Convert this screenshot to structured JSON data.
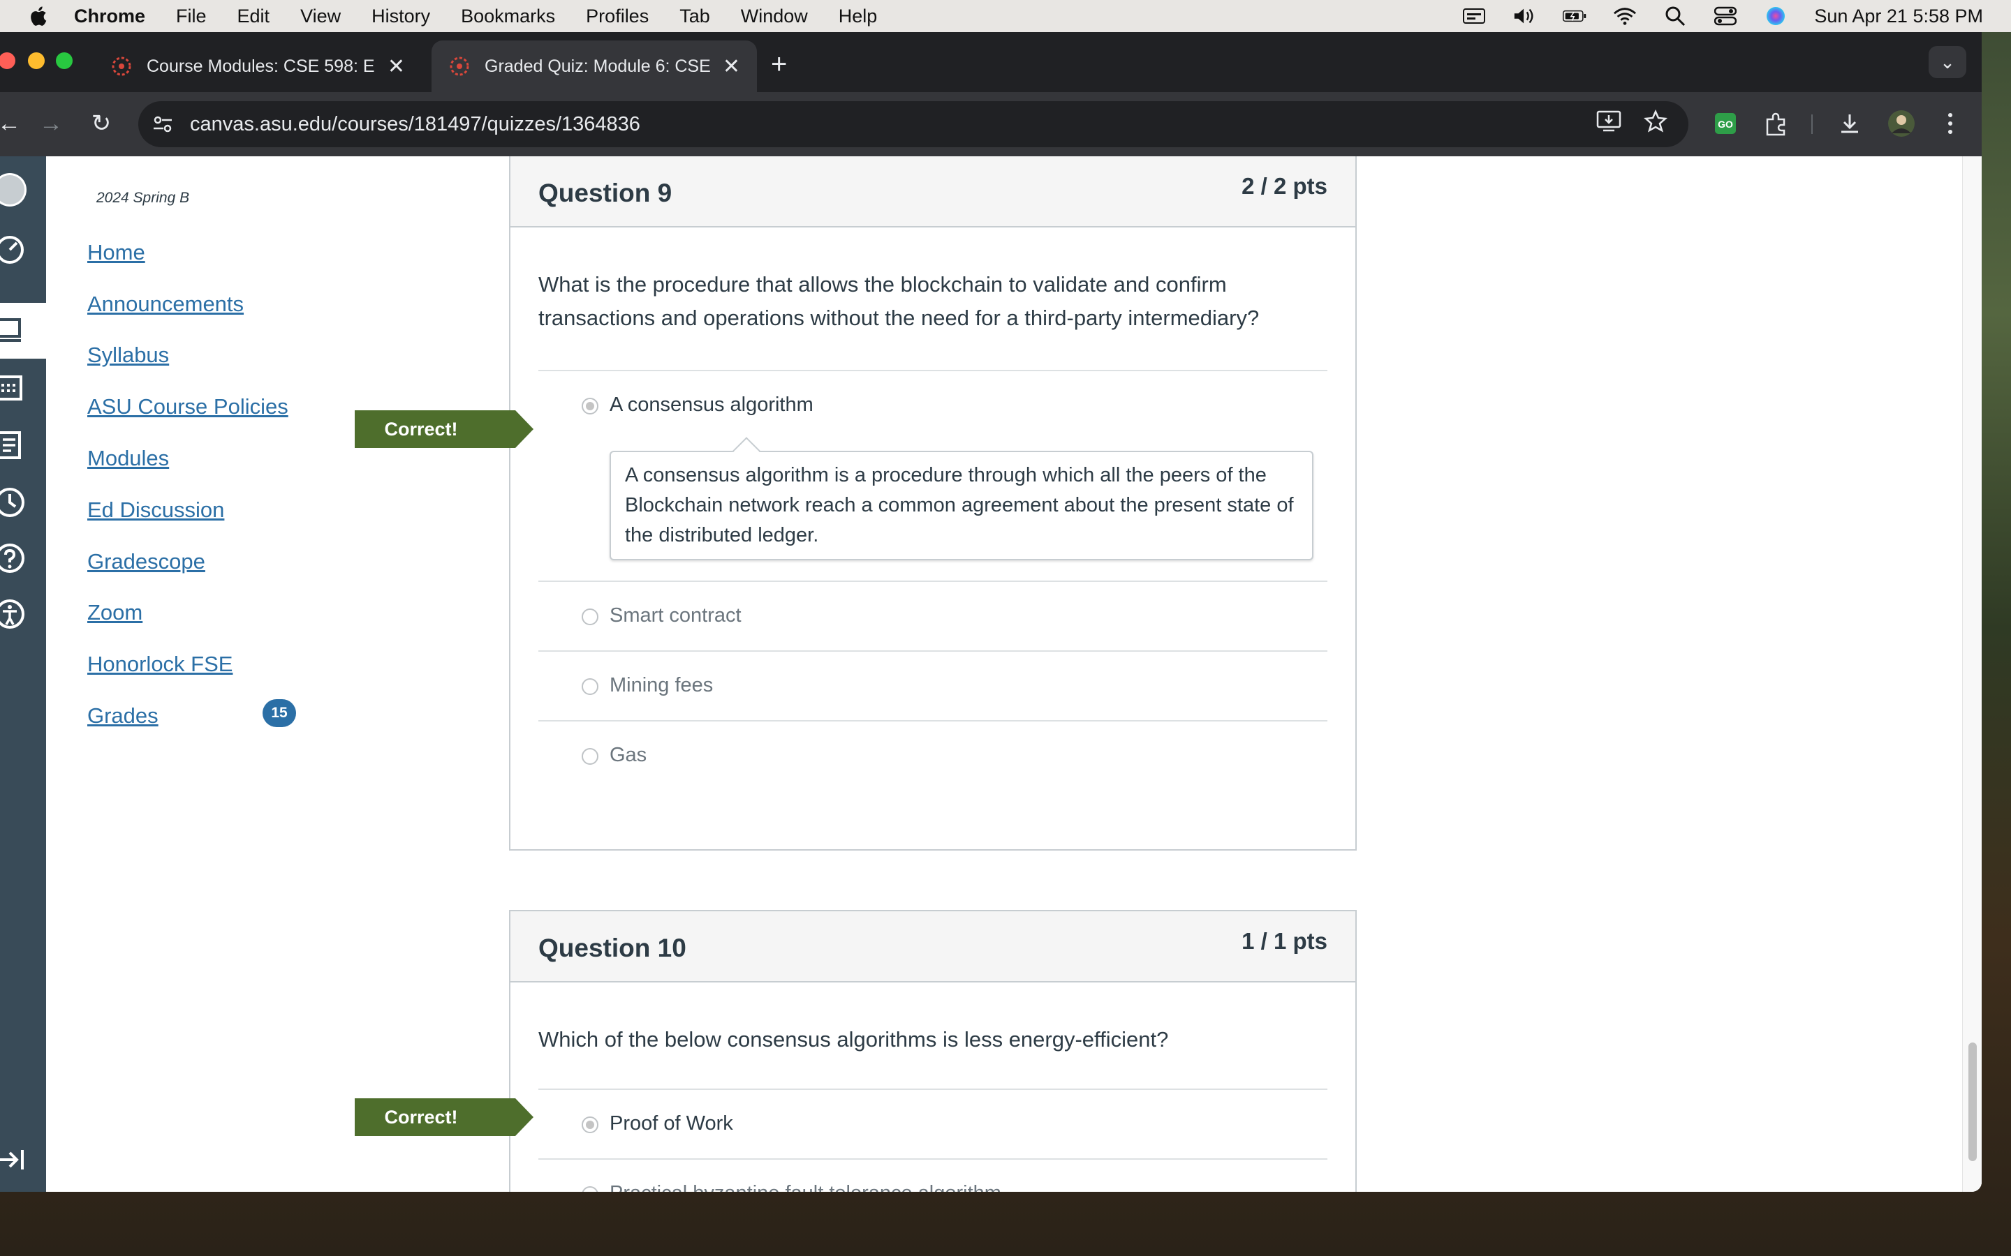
{
  "menubar": {
    "app": "Chrome",
    "items": [
      "File",
      "Edit",
      "View",
      "History",
      "Bookmarks",
      "Profiles",
      "Tab",
      "Window",
      "Help"
    ],
    "clock": "Sun Apr 21  5:58 PM"
  },
  "browser": {
    "tabs": [
      {
        "title": "Course Modules: CSE 598: E",
        "active": false
      },
      {
        "title": "Graded Quiz: Module 6: CSE",
        "active": true
      }
    ],
    "url": "canvas.asu.edu/courses/181497/quizzes/1364836"
  },
  "course_nav": {
    "term": "2024 Spring B",
    "links": [
      "Home",
      "Announcements",
      "Syllabus",
      "ASU Course Policies",
      "Modules",
      "Ed Discussion",
      "Gradescope",
      "Zoom",
      "Honorlock FSE",
      "Grades"
    ],
    "grades_badge": "15"
  },
  "questions": [
    {
      "title": "Question 9",
      "points": "2 / 2 pts",
      "text": "What is the procedure that allows the blockchain to validate and confirm transactions and operations without the need for a third-party intermediary?",
      "flag": "Correct!",
      "answers": [
        {
          "label": "A consensus algorithm",
          "selected": true
        },
        {
          "label": "Smart contract",
          "selected": false
        },
        {
          "label": "Mining fees",
          "selected": false
        },
        {
          "label": "Gas",
          "selected": false
        }
      ],
      "comment": "A consensus algorithm is a procedure through which all the peers of the Blockchain network reach a common agreement about the present state of the distributed ledger."
    },
    {
      "title": "Question 10",
      "points": "1 / 1 pts",
      "text": "Which of the below consensus algorithms is less energy-efficient?",
      "flag": "Correct!",
      "answers": [
        {
          "label": "Proof of Work",
          "selected": true
        },
        {
          "label": "Practical byzantine fault tolerance algorithm",
          "selected": false
        }
      ]
    }
  ],
  "colors": {
    "canvas_nav": "#394b58",
    "link": "#2b6fa6",
    "correct_flag": "#4e6e2c"
  }
}
